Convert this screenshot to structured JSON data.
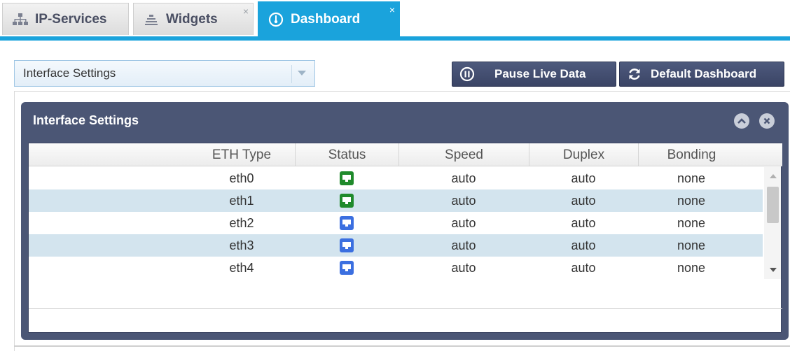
{
  "tabs": [
    {
      "label": "IP-Services",
      "icon": "network-tree-icon",
      "active": false,
      "closable": false
    },
    {
      "label": "Widgets",
      "icon": "stack-icon",
      "active": false,
      "closable": true
    },
    {
      "label": "Dashboard",
      "icon": "gauge-icon",
      "active": true,
      "closable": true
    }
  ],
  "tab_close_glyph": "×",
  "toolbar": {
    "widget_select": {
      "value": "Interface Settings"
    },
    "pause_button": {
      "label": "Pause Live Data",
      "icon": "pause-circle-icon"
    },
    "default_button": {
      "label": "Default Dashboard",
      "icon": "refresh-icon"
    }
  },
  "widget": {
    "title": "Interface Settings",
    "controls": [
      "collapse-icon",
      "close-icon"
    ]
  },
  "table": {
    "columns": [
      "",
      "ETH Type",
      "Status",
      "Speed",
      "Duplex",
      "Bonding"
    ],
    "rows": [
      {
        "eth": "eth0",
        "status": "up",
        "speed": "auto",
        "duplex": "auto",
        "bonding": "none"
      },
      {
        "eth": "eth1",
        "status": "up",
        "speed": "auto",
        "duplex": "auto",
        "bonding": "none"
      },
      {
        "eth": "eth2",
        "status": "down",
        "speed": "auto",
        "duplex": "auto",
        "bonding": "none"
      },
      {
        "eth": "eth3",
        "status": "down",
        "speed": "auto",
        "duplex": "auto",
        "bonding": "none"
      },
      {
        "eth": "eth4",
        "status": "down",
        "speed": "auto",
        "duplex": "auto",
        "bonding": "none"
      }
    ]
  },
  "colors": {
    "accent": "#1aa3dc",
    "panel": "#4b5675",
    "button": "#44506f",
    "row_alt": "#d3e4ee",
    "status_up": "#1f8a2b",
    "status_down": "#3b6fe0"
  }
}
